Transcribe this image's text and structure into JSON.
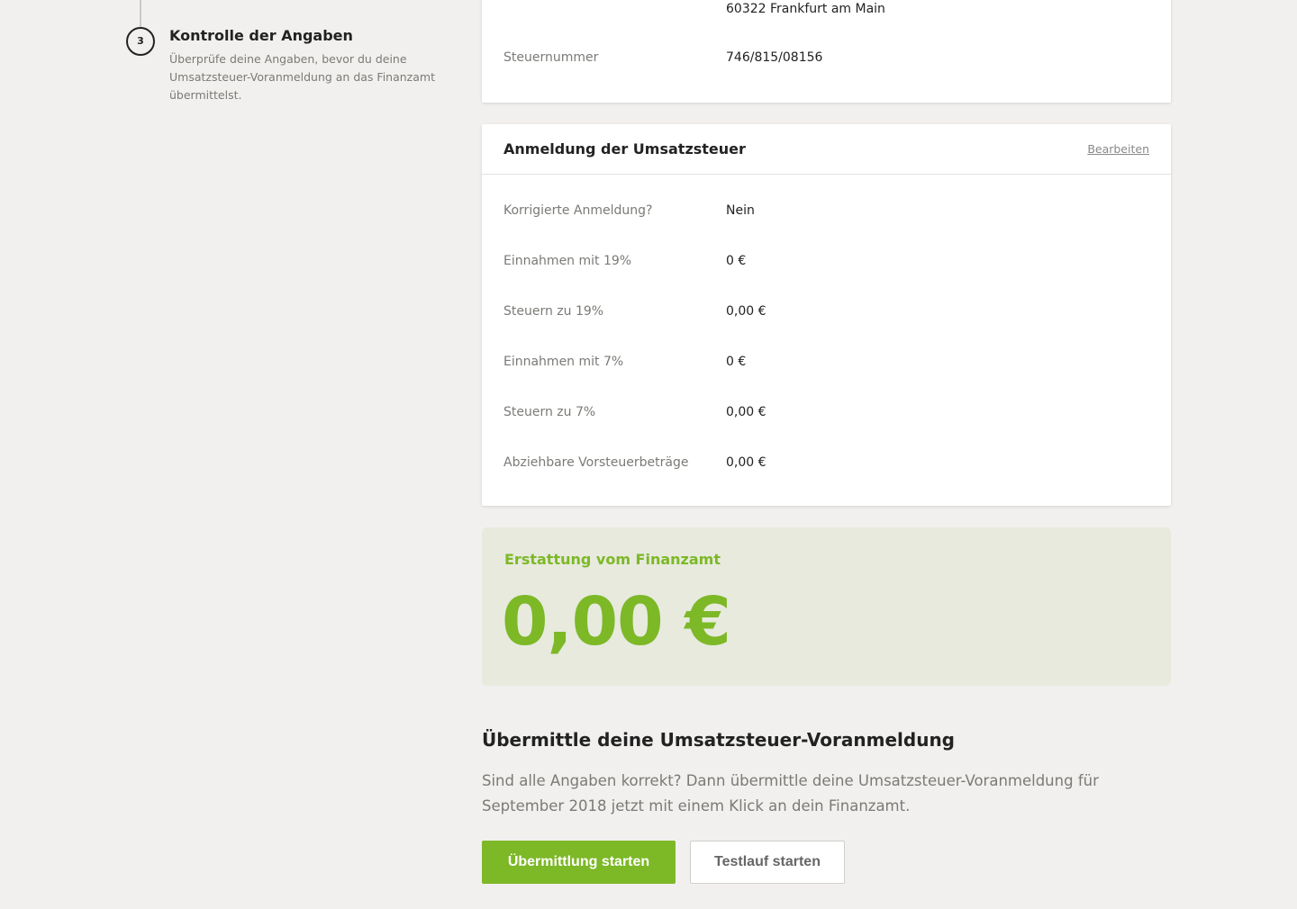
{
  "stepper": {
    "number": "3",
    "title": "Kontrolle der Angaben",
    "description": "Überprüfe deine Angaben, bevor du deine Umsatzsteuer-Voranmeldung an das Finanzamt übermittelst."
  },
  "top_card": {
    "address_line": "60322 Frankfurt am Main",
    "tax_number_label": "Steuernummer",
    "tax_number_value": "746/815/08156"
  },
  "vat_card": {
    "title": "Anmeldung der Umsatzsteuer",
    "edit_label": "Bearbeiten",
    "rows": [
      {
        "label": "Korrigierte Anmeldung?",
        "value": "Nein"
      },
      {
        "label": "Einnahmen mit 19%",
        "value": "0 €"
      },
      {
        "label": "Steuern zu 19%",
        "value": "0,00 €"
      },
      {
        "label": "Einnahmen mit 7%",
        "value": "0 €"
      },
      {
        "label": "Steuern zu 7%",
        "value": "0,00 €"
      },
      {
        "label": "Abziehbare Vorsteuerbeträge",
        "value": "0,00 €"
      }
    ]
  },
  "refund": {
    "label": "Erstattung vom Finanzamt",
    "amount": "0,00 €"
  },
  "submit": {
    "title": "Übermittle deine Umsatzsteuer-Voranmeldung",
    "text": "Sind alle Angaben korrekt? Dann übermittle deine Umsatzsteuer-Voranmeldung für September 2018 jetzt mit einem Klick an dein Finanzamt.",
    "primary_button": "Übermittlung starten",
    "secondary_button": "Testlauf starten"
  },
  "colors": {
    "accent": "#7db827",
    "refund_bg": "#e7eadd",
    "page_bg": "#f1f0ee"
  }
}
